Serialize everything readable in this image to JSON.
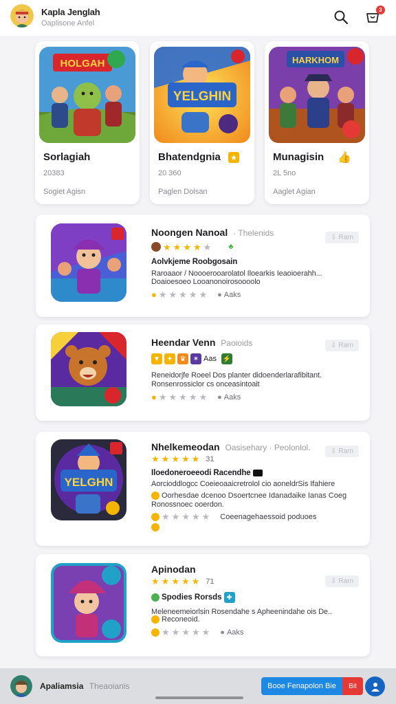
{
  "header": {
    "title": "Kapla Jenglah",
    "subtitle": "Oaplisone Anfel",
    "notification_count": "3",
    "icons": [
      "profile-avatar",
      "search-icon",
      "bag-icon"
    ]
  },
  "featured": [
    {
      "title": "Sorlagiah",
      "num": "20383",
      "tag": "Sogiet Agisn",
      "thumb_text": "HOLGAH",
      "badge_icon": "trophy-icon"
    },
    {
      "title": "Bhatendgnia",
      "num": "20 360",
      "tag": "Paglen Dolsan",
      "thumb_text": "YELGHIN",
      "badge_icon": "star-badge-icon"
    },
    {
      "title": "Munagisin",
      "num": "2L 5no",
      "tag": "Aaglet Agian",
      "thumb_text": "HARKHOM",
      "badge_icon": "thumbs-up-icon"
    }
  ],
  "list": [
    {
      "title": "Noongen Nanoal",
      "muted": "· Thelenids",
      "get": "Rarn",
      "rating_row": "",
      "headline": "Aolvkjeme Roobgosain",
      "desc": "Raroaaor / Noooerooarolatol Iloearkis Ieaoioerahh...",
      "desc2": "Doaioesoeo Looanonoirosoooolo",
      "footer": "Aaks"
    },
    {
      "title": "Heendar Venn",
      "muted": "Paoioids",
      "get": "Rarn",
      "rating_row": "Aas",
      "headline": "",
      "desc": "Reneidorjfe Roeel Dos planter didoenderlarafibitant.",
      "desc2": "Ronsenrossiclor cs onceasintoait",
      "footer": "Aaks"
    },
    {
      "title": "Nhelkemeodan",
      "muted": "Oasisehary · Peolonlol.",
      "get": "Rarn",
      "rating_row": "31",
      "headline": "Iloedoneroeeodi Racendhe",
      "desc": "Aorcioddlogcc Coeieoaaicretrolol cio aoneldrSis Ifahiere",
      "desc2": "Oorhesdae dcenoo Dsoertcnee Idanadaike Ianas Coeg",
      "desc3": "Ronossnoec ooerdon.",
      "footer": "Coeenagehaessoid poduoes"
    },
    {
      "title": "Apinodan",
      "muted": "",
      "get": "Rarn",
      "rating_row": "71",
      "headline": "Spodies Rorsds",
      "desc": "Meleneemeiorlsin Rosendahe s Apheenindahe ois De..",
      "desc2": "Reconeoid.",
      "footer": "Aaks"
    }
  ],
  "bottom": {
    "name": "Apaliamsia",
    "muted": "Theaoianis",
    "primary": "Booe Fenapolon Bie",
    "secondary": "Bit"
  },
  "colors": {
    "accent": "#1e88e5",
    "danger": "#e53935",
    "star": "#f5b400"
  }
}
